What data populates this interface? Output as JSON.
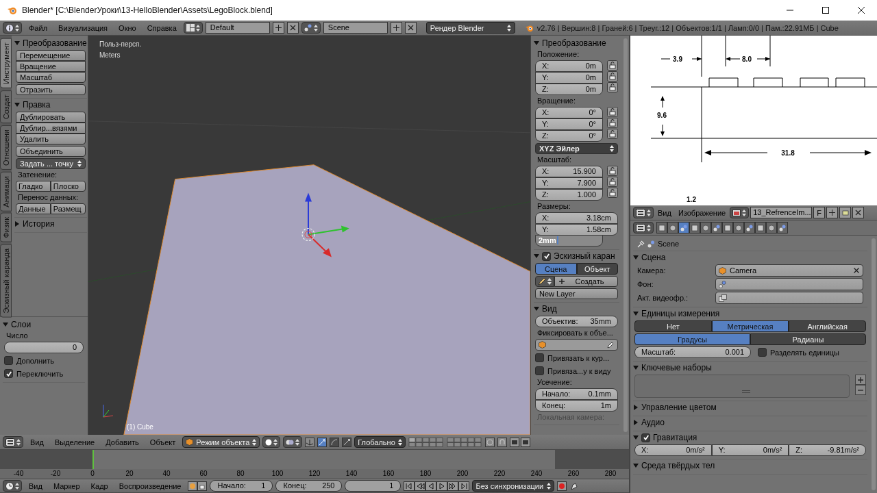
{
  "title_bar": {
    "title": "Blender* [C:\\BlenderУроки\\13-HelloBlender\\Assets\\LegoBlock.blend]"
  },
  "info_header": {
    "menu": [
      "Файл",
      "Визуализация",
      "Окно",
      "Справка"
    ],
    "layout": "Default",
    "scene": "Scene",
    "engine": "Рендер Blender",
    "stats": "v2.76 | Вершин:8 | Граней:6 | Треуг.:12 | Объектов:1/1 | Ламп:0/0 | Пам.:22.91МБ | Cube"
  },
  "tool_tabs": [
    {
      "label": "Инструмент",
      "selected": true
    },
    {
      "label": "Создат",
      "selected": false
    },
    {
      "label": "Отношени",
      "selected": false
    },
    {
      "label": "Анимаци",
      "selected": false
    },
    {
      "label": "Физик",
      "selected": false
    },
    {
      "label": "Эскизный каранда",
      "selected": false
    }
  ],
  "tool_panels": [
    {
      "title": "Преобразование",
      "expanded": true,
      "items": [
        {
          "kind": "buttons",
          "labels": [
            "Перемещение",
            "Вращение",
            "Масштаб"
          ]
        },
        {
          "kind": "button",
          "label": "Отразить"
        }
      ]
    },
    {
      "title": "Правка",
      "expanded": true,
      "items": [
        {
          "kind": "buttons",
          "labels": [
            "Дублировать",
            "Дублир...вязями",
            "Удалить"
          ]
        },
        {
          "kind": "button",
          "label": "Объединить"
        },
        {
          "kind": "dropdown",
          "label": "Задать ... точку"
        },
        {
          "kind": "label",
          "text": "Затенение:",
          "disabled": false
        },
        {
          "kind": "row",
          "labels": [
            "Гладко",
            "Плоско"
          ]
        },
        {
          "kind": "label",
          "text": "Перенос данных:",
          "disabled": false
        },
        {
          "kind": "row",
          "labels": [
            "Данные",
            "Размещ"
          ]
        }
      ]
    },
    {
      "title": "История",
      "expanded": false
    }
  ],
  "layers_panel": {
    "title": "Слои",
    "expanded": true,
    "items": [
      {
        "kind": "label",
        "text": "Число",
        "disabled": false
      },
      {
        "kind": "number",
        "value": "0"
      },
      {
        "kind": "checkbox",
        "label": "Дополнить",
        "checked": false
      },
      {
        "kind": "checkbox",
        "label": "Переключить",
        "checked": true
      }
    ]
  },
  "viewport": {
    "view_name": "Польз-персп.",
    "units": "Meters",
    "object_label": "(1) Cube"
  },
  "n_panel": [
    {
      "title": "Преобразование",
      "expanded": true,
      "items": [
        {
          "kind": "label",
          "text": "Положение:",
          "disabled": false
        },
        {
          "kind": "vector",
          "locks": true,
          "fields": [
            {
              "label": "X:",
              "value": "0m"
            },
            {
              "label": "Y:",
              "value": "0m"
            },
            {
              "label": "Z:",
              "value": "0m"
            }
          ]
        },
        {
          "kind": "label",
          "text": "Вращение:",
          "disabled": false
        },
        {
          "kind": "vector",
          "locks": true,
          "fields": [
            {
              "label": "X:",
              "value": "0°"
            },
            {
              "label": "Y:",
              "value": "0°"
            },
            {
              "label": "Z:",
              "value": "0°"
            }
          ]
        },
        {
          "kind": "dark-dropdown",
          "label": "XYZ Эйлер"
        },
        {
          "kind": "label",
          "text": "Масштаб:",
          "disabled": false
        },
        {
          "kind": "vector",
          "locks": true,
          "fields": [
            {
              "label": "X:",
              "value": "15.900"
            },
            {
              "label": "Y:",
              "value": "7.900"
            },
            {
              "label": "Z:",
              "value": "1.000"
            }
          ]
        },
        {
          "kind": "label",
          "text": "Размеры:",
          "disabled": false
        },
        {
          "kind": "vector",
          "locks": false,
          "fields": [
            {
              "label": "X:",
              "value": "3.18cm"
            },
            {
              "label": "Y:",
              "value": "1.58cm"
            }
          ]
        },
        {
          "kind": "editing",
          "value": "2mm"
        }
      ]
    },
    {
      "title": "Эскизный каран",
      "expanded": true,
      "checked": true,
      "items": [
        {
          "kind": "toggle",
          "options": [
            {
              "label": "Сцена",
              "selected": true
            },
            {
              "label": "Объект",
              "selected": false
            }
          ]
        },
        {
          "kind": "create",
          "label": "Создать"
        },
        {
          "kind": "button",
          "label": "New Layer"
        }
      ]
    },
    {
      "title": "Вид",
      "expanded": true,
      "items": [
        {
          "kind": "number",
          "label": "Объектив:",
          "value": "35mm"
        },
        {
          "kind": "label",
          "text": "Фиксировать к объе...",
          "disabled": false
        },
        {
          "kind": "object-field"
        },
        {
          "kind": "checkbox",
          "label": "Привязать к кур...",
          "checked": false
        },
        {
          "kind": "checkbox",
          "label": "Привяза...у к виду",
          "checked": false
        },
        {
          "kind": "label",
          "text": "Усечение:",
          "disabled": false
        },
        {
          "kind": "vector",
          "locks": false,
          "fields": [
            {
              "label": "Начало:",
              "value": "0.1mm"
            },
            {
              "label": "Конец:",
              "value": "1m"
            }
          ]
        },
        {
          "kind": "label",
          "text": "Локальная камера:",
          "disabled": true
        }
      ]
    }
  ],
  "image_editor": {
    "labels": [
      "3.9",
      "8.0",
      "9.6",
      "31.8",
      "1.2"
    ],
    "menu": [
      "Вид",
      "Изображение"
    ],
    "image": "13_RefrenceIm...",
    "fake_user": "F"
  },
  "properties": {
    "tabs": [
      {
        "selected": false
      },
      {
        "selected": false
      },
      {
        "selected": true
      },
      {
        "selected": false
      },
      {
        "selected": false
      },
      {
        "selected": false
      },
      {
        "selected": false
      },
      {
        "selected": false
      },
      {
        "selected": false
      },
      {
        "selected": false
      },
      {
        "selected": false
      },
      {
        "selected": false
      }
    ],
    "context": "Scene",
    "sections": [
      {
        "title": "Сцена",
        "expanded": true,
        "items": [
          {
            "kind": "prop",
            "label": "Камера:",
            "value": "Camera"
          },
          {
            "kind": "prop",
            "label": "Фон:",
            "value": ""
          },
          {
            "kind": "prop",
            "label": "Акт. видеофр.:",
            "value": ""
          }
        ]
      },
      {
        "title": "Единицы измерения",
        "expanded": true,
        "items": [
          {
            "kind": "toggle",
            "options": [
              {
                "label": "Нет",
                "selected": false
              },
              {
                "label": "Метрическая",
                "selected": true
              },
              {
                "label": "Английская",
                "selected": false
              }
            ]
          },
          {
            "kind": "toggle",
            "options": [
              {
                "label": "Градусы",
                "selected": true
              },
              {
                "label": "Радианы",
                "selected": false
              }
            ]
          },
          {
            "kind": "pair",
            "items": [
              {
                "kind": "number",
                "label": "Масштаб:",
                "value": "0.001"
              },
              {
                "kind": "checkbox",
                "label": "Разделять единицы",
                "checked": false
              }
            ]
          }
        ]
      },
      {
        "title": "Ключевые наборы",
        "expanded": true,
        "items": [
          {
            "kind": "list"
          }
        ]
      },
      {
        "title": "Управление цветом",
        "expanded": false
      },
      {
        "title": "Аудио",
        "expanded": false
      },
      {
        "title": "Гравитация",
        "expanded": true,
        "checked": true,
        "items": [
          {
            "kind": "hvector",
            "fields": [
              {
                "label": "X:",
                "value": "0m/s²"
              },
              {
                "label": "Y:",
                "value": "0m/s²"
              },
              {
                "label": "Z:",
                "value": "-9.81m/s²"
              }
            ]
          }
        ]
      },
      {
        "title": "Среда твёрдых тел",
        "expanded": true
      }
    ]
  },
  "view3d_header": {
    "menu": [
      "Вид",
      "Выделение",
      "Добавить",
      "Объект"
    ],
    "mode": "Режим объекта",
    "orientation": "Глобально"
  },
  "timeline": {
    "ticks": [
      "-40",
      "-20",
      "0",
      "20",
      "40",
      "60",
      "80",
      "100",
      "120",
      "140",
      "160",
      "180",
      "200",
      "220",
      "240",
      "260",
      "280"
    ],
    "menu": [
      "Вид",
      "Маркер",
      "Кадр",
      "Воспроизведение"
    ],
    "start_label": "Начало:",
    "start": "1",
    "end_label": "Конец:",
    "end": "250",
    "current": "1",
    "sync": "Без синхронизации"
  }
}
